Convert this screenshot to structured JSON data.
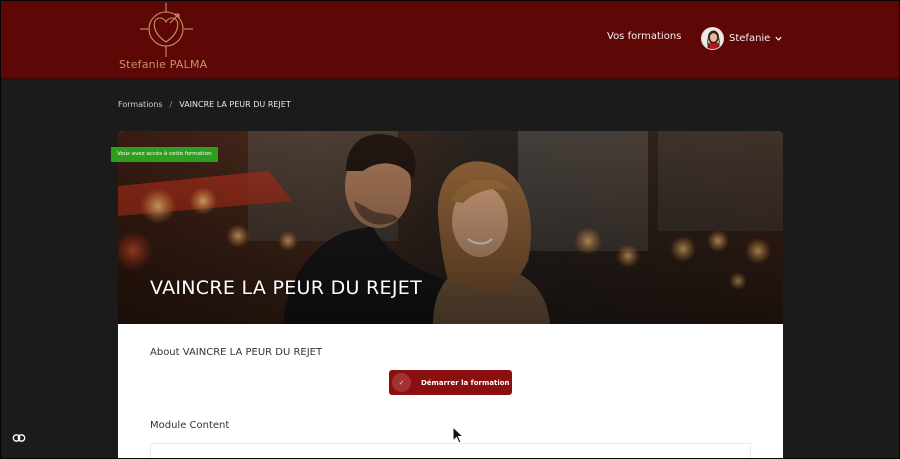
{
  "header": {
    "logo_text": "Stefanie PALMA",
    "nav_courses": "Vos formations",
    "user_name": "Stefanie",
    "colors": {
      "background": "#5d0707",
      "logo": "#c99366"
    }
  },
  "breadcrumb": {
    "root": "Formations",
    "separator": "/",
    "current": "VAINCRE LA PEUR DU REJET"
  },
  "course": {
    "title": "VAINCRE LA PEUR DU REJET",
    "access_badge": "Vous avez accès à cette formation",
    "about": "About VAINCRE LA PEUR DU REJET",
    "start_button": "Démarrer la formation",
    "module_heading": "Module Content"
  },
  "icons": [
    "heart-compass-logo-icon",
    "chevron-down-icon",
    "check-icon",
    "cookie-icon",
    "mouse-cursor-icon"
  ],
  "colors": {
    "accent": "#8a1010",
    "badge": "#2e9e1f",
    "page_bg": "#1b1b1b"
  }
}
